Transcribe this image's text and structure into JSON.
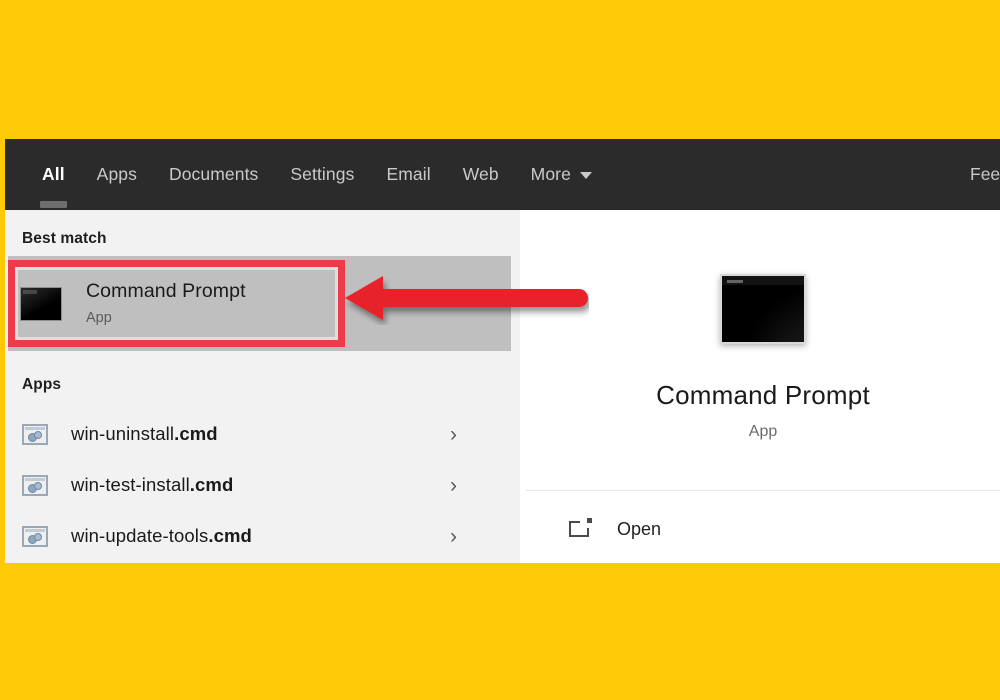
{
  "theme": {
    "page_background": "#FFC907",
    "tabbar_background": "#2B2B2B",
    "left_pane_background": "#F2F2F2",
    "right_pane_background": "#FFFFFF",
    "selection_background": "#BFBFBF",
    "annotation_red": "#EE3B4B",
    "arrow_red": "#E8232A"
  },
  "tabbar": {
    "tabs": [
      {
        "label": "All",
        "active": true
      },
      {
        "label": "Apps",
        "active": false
      },
      {
        "label": "Documents",
        "active": false
      },
      {
        "label": "Settings",
        "active": false
      },
      {
        "label": "Email",
        "active": false
      },
      {
        "label": "Web",
        "active": false
      },
      {
        "label": "More",
        "active": false,
        "caret": "chevron-down-icon"
      }
    ],
    "feedback_label": "Fee"
  },
  "results": {
    "best_match_label": "Best match",
    "best_match": {
      "title": "Command Prompt",
      "subtitle": "App",
      "icon": "command-prompt-icon",
      "selected": true,
      "highlighted": true
    },
    "apps_label": "Apps",
    "apps": [
      {
        "name": "win-uninstall",
        "ext": ".cmd",
        "icon": "cmd-script-icon",
        "chevron": "›"
      },
      {
        "name": "win-test-install",
        "ext": ".cmd",
        "icon": "cmd-script-icon",
        "chevron": "›"
      },
      {
        "name": "win-update-tools",
        "ext": ".cmd",
        "icon": "cmd-script-icon",
        "chevron": "›"
      }
    ]
  },
  "preview": {
    "icon": "command-prompt-icon",
    "title": "Command Prompt",
    "subtitle": "App",
    "actions": [
      {
        "label": "Open",
        "icon": "open-in-new-icon"
      }
    ]
  },
  "annotation": {
    "arrow": "left-pointing-arrow",
    "arrow_color": "#E8232A",
    "box_color": "#EE3B4B"
  }
}
